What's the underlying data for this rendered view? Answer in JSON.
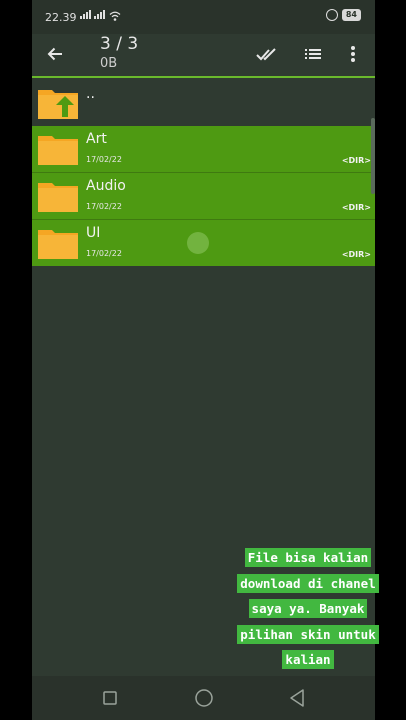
{
  "status_bar": {
    "time": "22.39",
    "battery": "84"
  },
  "toolbar": {
    "count": "3 / 3",
    "size": "0B"
  },
  "list": {
    "parent_label": "..",
    "items": [
      {
        "name": "Art",
        "date": "17/02/22",
        "tag": "<DIR>"
      },
      {
        "name": "Audio",
        "date": "17/02/22",
        "tag": "<DIR>"
      },
      {
        "name": "UI",
        "date": "17/02/22",
        "tag": "<DIR>"
      }
    ]
  },
  "caption": {
    "lines": [
      "File bisa kalian",
      "download di chanel",
      "saya ya. Banyak",
      "pilihan skin untuk",
      "kalian"
    ]
  },
  "colors": {
    "selection": "#4e9a12",
    "accent": "#6ab92c",
    "folder": "#f5a623",
    "background": "#2f3a31",
    "caption_bg": "#42b840"
  }
}
